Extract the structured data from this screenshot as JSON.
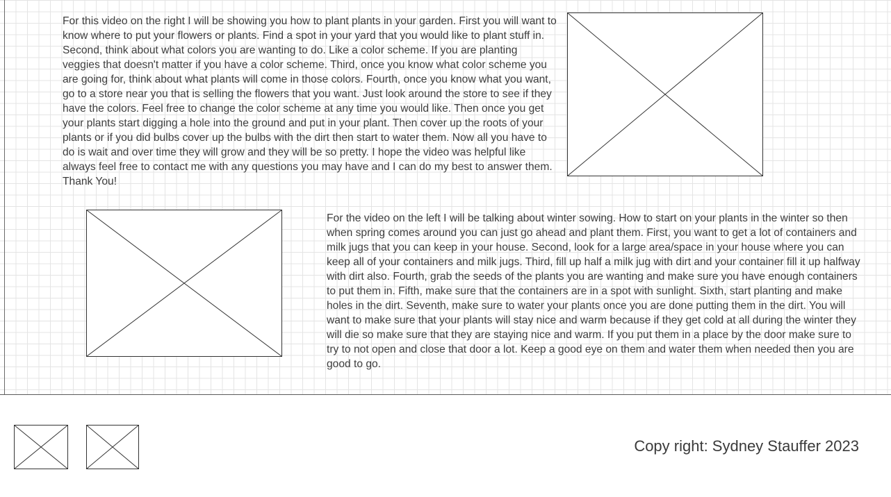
{
  "sections": {
    "planting": {
      "text": "For this video on the right I will be showing you how to plant plants in your garden. First you will want to know where to put your flowers or plants. Find a spot in your yard that you would like to plant stuff in. Second, think about what colors you are wanting to do. Like a color scheme. If you are planting veggies that doesn't matter if you have a color scheme. Third, once you know what color scheme you are going for, think about what plants will come in those colors. Fourth, once you know what you want, go to a store near you that is selling the flowers that you want. Just look around the store to see if they have the colors. Feel free to change the color scheme at any time you would like. Then once you get your plants start digging a hole into the ground and put in your plant. Then cover up the roots of your plants or if you did bulbs cover up the bulbs with the dirt then start to water them. Now all you have to do is wait and over time they will grow and they will be so pretty. I hope the video was helpful like always feel free to contact me with any questions you may have and I can do my best to answer them. Thank You!"
    },
    "winter_sowing": {
      "text": "For the video on the left I will be talking about winter sowing. How to start on your plants in the winter so then when spring comes around you can just go ahead and plant them. First, you want to get a lot of containers and milk jugs that you can keep in your house. Second, look for a large area/space in your house where you can keep all of your containers and milk jugs. Third, fill up half a milk jug with dirt and your container fill it up halfway with dirt also. Fourth, grab the seeds of the plants you are wanting and make sure you have enough containers to put them in. Fifth, make sure that the containers are in a spot with sunlight. Sixth, start planting and make holes in the dirt. Seventh, make sure to water your plants once you are done putting them in the dirt. You will want to make sure that your plants will stay nice and warm because if they get cold at all during the winter they will die so make sure that they are staying nice and warm. If you put them in a place by the door make sure to try to not open and close that door a lot. Keep a good eye on them and water them when needed then you are good to go."
    }
  },
  "footer": {
    "copyright": "Copy right: Sydney Stauffer 2023"
  }
}
